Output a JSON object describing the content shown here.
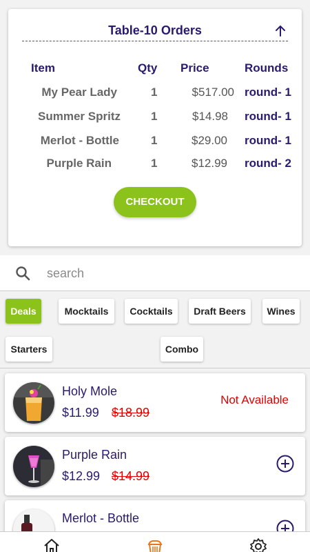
{
  "order": {
    "title": "Table-10 Orders",
    "headers": {
      "item": "Item",
      "qty": "Qty",
      "price": "Price",
      "rounds": "Rounds"
    },
    "rows": [
      {
        "item": "My Pear Lady",
        "qty": "1",
        "price": "$517.00",
        "round": "round- 1"
      },
      {
        "item": "Summer Spritz",
        "qty": "1",
        "price": "$14.98",
        "round": "round- 1"
      },
      {
        "item": "Merlot - Bottle",
        "qty": "1",
        "price": "$29.00",
        "round": "round- 1"
      },
      {
        "item": "Purple Rain",
        "qty": "1",
        "price": "$12.99",
        "round": "round- 2"
      }
    ],
    "checkout_label": "CHECKOUT"
  },
  "search": {
    "placeholder": "search"
  },
  "categories": {
    "deals": "Deals",
    "mocktails": "Mocktails",
    "cocktails": "Cocktails",
    "draft_beers": "Draft Beers",
    "wines": "Wines",
    "starters": "Starters",
    "combo": "Combo"
  },
  "menu_items": [
    {
      "name": "Holy Mole",
      "price": "$11.99",
      "old_price": "$18.99",
      "status": "Not Available"
    },
    {
      "name": "Purple Rain",
      "price": "$12.99",
      "old_price": "$14.99"
    },
    {
      "name": "Merlot - Bottle",
      "price": "",
      "old_price": ""
    }
  ],
  "colors": {
    "accent": "#8cc21c",
    "primary_text": "#2a1a6e",
    "alert": "#e00000",
    "nav_active": "#e8761c"
  },
  "nav": {
    "icons": [
      "home-icon",
      "menu-icon",
      "settings-icon"
    ],
    "active": "menu-icon"
  }
}
